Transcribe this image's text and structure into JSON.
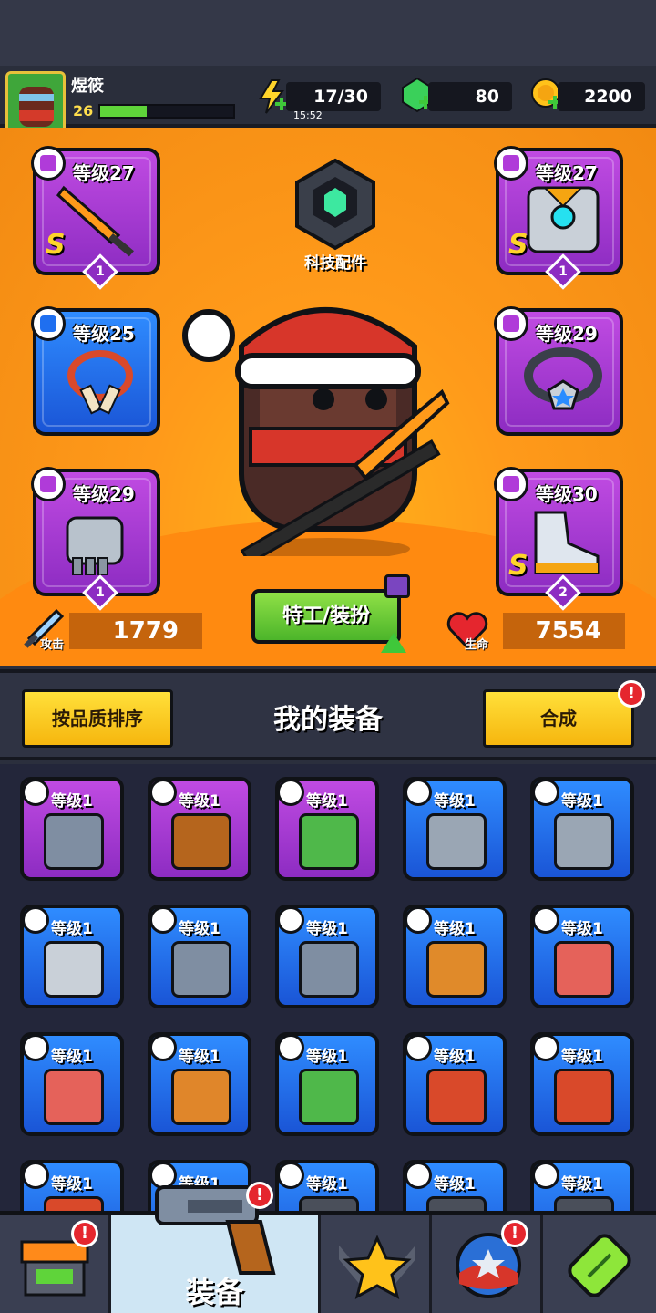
{
  "player": {
    "name": "煜筱",
    "level": "26",
    "xp_fraction": 0.35
  },
  "resources": {
    "energy": "17/30",
    "energy_timer": "15:52",
    "gems": "80",
    "coins": "2200"
  },
  "tech_parts": {
    "label": "科技配件"
  },
  "equipped": [
    {
      "level": "等级27",
      "grade": "S",
      "stars": "1",
      "rarity": "purple",
      "icon": "sword-icon"
    },
    {
      "level": "等级27",
      "grade": "S",
      "stars": "1",
      "rarity": "purple",
      "icon": "armor-icon"
    },
    {
      "level": "等级25",
      "grade": "",
      "stars": "",
      "rarity": "blue",
      "icon": "necklace-icon"
    },
    {
      "level": "等级29",
      "grade": "",
      "stars": "",
      "rarity": "purple",
      "icon": "ring-icon"
    },
    {
      "level": "等级29",
      "grade": "",
      "stars": "1",
      "rarity": "purple",
      "icon": "gauntlet-icon"
    },
    {
      "level": "等级30",
      "grade": "S",
      "stars": "2",
      "rarity": "purple",
      "icon": "boot-icon"
    }
  ],
  "stats": {
    "attack_label": "攻击",
    "attack_value": "1779",
    "hp_label": "生命",
    "hp_value": "7554"
  },
  "agent_button": "特工/装扮",
  "equipment_bar": {
    "sort_button": "按品质排序",
    "title": "我的装备",
    "merge_button": "合成",
    "merge_alert": "!"
  },
  "inventory": [
    {
      "level": "等级1",
      "rarity": "purple",
      "icon": "revolver-icon"
    },
    {
      "level": "等级1",
      "rarity": "purple",
      "icon": "shotgun-icon"
    },
    {
      "level": "等级1",
      "rarity": "purple",
      "icon": "vest-icon"
    },
    {
      "level": "等级1",
      "rarity": "blue",
      "icon": "kunai-icon"
    },
    {
      "level": "等级1",
      "rarity": "blue",
      "icon": "kunai-icon"
    },
    {
      "level": "等级1",
      "rarity": "blue",
      "icon": "machete-icon"
    },
    {
      "level": "等级1",
      "rarity": "blue",
      "icon": "revolver-icon"
    },
    {
      "level": "等级1",
      "rarity": "blue",
      "icon": "revolver-icon"
    },
    {
      "level": "等级1",
      "rarity": "blue",
      "icon": "bat-icon"
    },
    {
      "level": "等级1",
      "rarity": "blue",
      "icon": "shirt-icon"
    },
    {
      "level": "等级1",
      "rarity": "blue",
      "icon": "shirt-icon"
    },
    {
      "level": "等级1",
      "rarity": "blue",
      "icon": "jacket-icon"
    },
    {
      "level": "等级1",
      "rarity": "blue",
      "icon": "vest-icon"
    },
    {
      "level": "等级1",
      "rarity": "blue",
      "icon": "necklace-icon"
    },
    {
      "level": "等级1",
      "rarity": "blue",
      "icon": "necklace-icon"
    },
    {
      "level": "等级1",
      "rarity": "blue",
      "icon": "necklace-icon"
    },
    {
      "level": "等级1",
      "rarity": "blue",
      "icon": "necklace-icon"
    },
    {
      "level": "等级1",
      "rarity": "blue",
      "icon": "ring-icon"
    },
    {
      "level": "等级1",
      "rarity": "blue",
      "icon": "ring-icon"
    },
    {
      "level": "等级1",
      "rarity": "blue",
      "icon": "ring-icon"
    }
  ],
  "nav": {
    "shop_alert": "!",
    "equip_label": "装备",
    "equip_alert": "!",
    "events_alert": "!"
  }
}
